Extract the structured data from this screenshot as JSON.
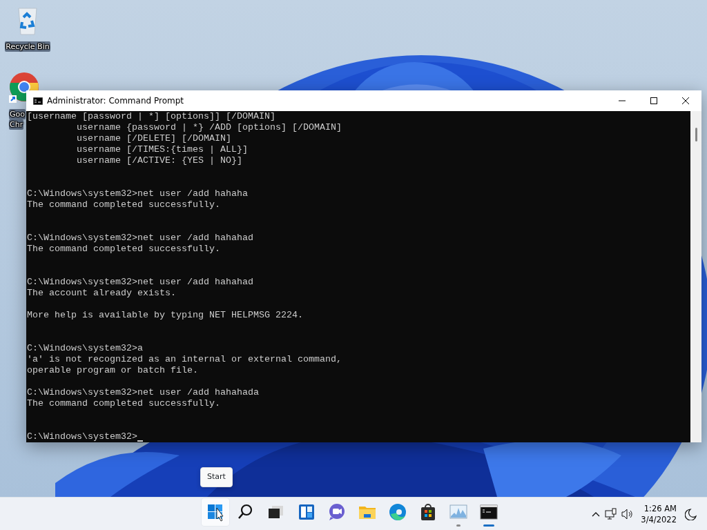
{
  "desktop_icons": [
    {
      "kind": "recycle",
      "label_lines": [
        "Recycle Bin"
      ]
    },
    {
      "kind": "chrome",
      "label_lines": [
        "Goo",
        "Chr"
      ]
    }
  ],
  "window": {
    "title": "Administrator: Command Prompt",
    "cursor": true,
    "lines": [
      {
        "kind": "text",
        "text": "[username [password | *] [options]] [/DOMAIN]"
      },
      {
        "kind": "text",
        "text": "         username {password | *} /ADD [options] [/DOMAIN]"
      },
      {
        "kind": "text",
        "text": "         username [/DELETE] [/DOMAIN]"
      },
      {
        "kind": "text",
        "text": "         username [/TIMES:{times | ALL}]"
      },
      {
        "kind": "text",
        "text": "         username [/ACTIVE: {YES | NO}]"
      },
      {
        "kind": "blank"
      },
      {
        "kind": "blank"
      },
      {
        "kind": "text",
        "text": "C:\\Windows\\system32>net user /add hahaha"
      },
      {
        "kind": "text",
        "text": "The command completed successfully."
      },
      {
        "kind": "blank"
      },
      {
        "kind": "blank"
      },
      {
        "kind": "text",
        "text": "C:\\Windows\\system32>net user /add hahahad"
      },
      {
        "kind": "text",
        "text": "The command completed successfully."
      },
      {
        "kind": "blank"
      },
      {
        "kind": "blank"
      },
      {
        "kind": "text",
        "text": "C:\\Windows\\system32>net user /add hahahad"
      },
      {
        "kind": "text",
        "text": "The account already exists."
      },
      {
        "kind": "blank"
      },
      {
        "kind": "text",
        "text": "More help is available by typing NET HELPMSG 2224."
      },
      {
        "kind": "blank"
      },
      {
        "kind": "blank"
      },
      {
        "kind": "text",
        "text": "C:\\Windows\\system32>a"
      },
      {
        "kind": "text",
        "text": "'a' is not recognized as an internal or external command,"
      },
      {
        "kind": "text",
        "text": "operable program or batch file."
      },
      {
        "kind": "blank"
      },
      {
        "kind": "text",
        "text": "C:\\Windows\\system32>net user /add hahahada"
      },
      {
        "kind": "text",
        "text": "The command completed successfully."
      },
      {
        "kind": "blank"
      },
      {
        "kind": "blank"
      },
      {
        "kind": "text",
        "text": "C:\\Windows\\system32>"
      }
    ]
  },
  "tooltip": {
    "text": "Start"
  },
  "taskbar": {
    "apps": [
      {
        "kind": "start",
        "hovered": true,
        "running": false,
        "active": false
      },
      {
        "kind": "search",
        "hovered": false,
        "running": false,
        "active": false
      },
      {
        "kind": "taskview",
        "hovered": false,
        "running": false,
        "active": false
      },
      {
        "kind": "widgets",
        "hovered": false,
        "running": false,
        "active": false
      },
      {
        "kind": "chat",
        "hovered": false,
        "running": false,
        "active": false
      },
      {
        "kind": "explorer",
        "hovered": false,
        "running": false,
        "active": false
      },
      {
        "kind": "edge",
        "hovered": false,
        "running": false,
        "active": false
      },
      {
        "kind": "store",
        "hovered": false,
        "running": false,
        "active": false
      },
      {
        "kind": "monitor",
        "hovered": false,
        "running": true,
        "active": false
      },
      {
        "kind": "terminal",
        "hovered": false,
        "running": true,
        "active": true
      }
    ]
  },
  "tray": {
    "time": "1:26 AM",
    "date": "3/4/2022"
  }
}
